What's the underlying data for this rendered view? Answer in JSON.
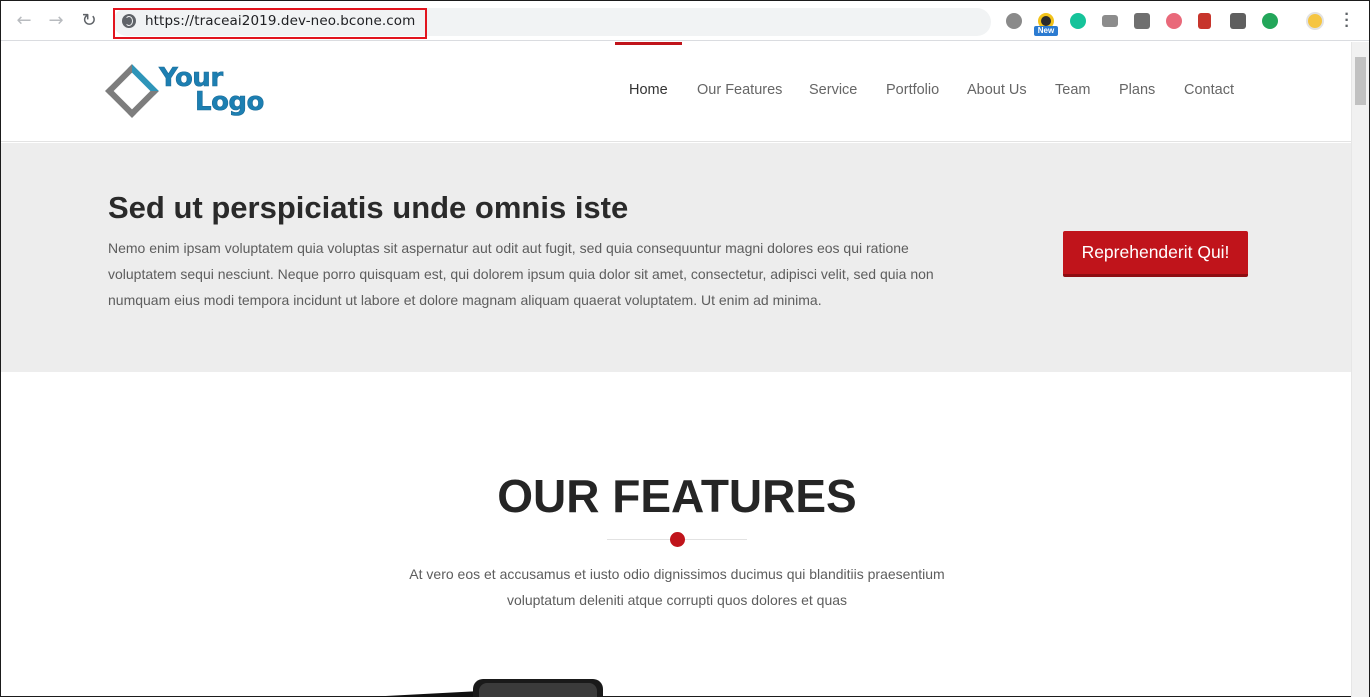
{
  "browser": {
    "url": "https://traceai2019.dev-neo.bcone.com",
    "back_icon": "←",
    "forward_icon": "→",
    "reload_icon": "↻",
    "new_badge": "New",
    "menu_icon": "⋮",
    "extensions": [
      "lock-ear-icon",
      "new-extension-icon",
      "grammarly-icon",
      "camera-icon",
      "pin-icon",
      "cookie-icon",
      "red-book-icon",
      "m-icon",
      "checkmark-icon",
      "profile-avatar-icon"
    ]
  },
  "header": {
    "logo_line1": "Your",
    "logo_line2": "Logo",
    "nav": [
      {
        "label": "Home"
      },
      {
        "label": "Our Features"
      },
      {
        "label": "Service"
      },
      {
        "label": "Portfolio"
      },
      {
        "label": "About Us"
      },
      {
        "label": "Team"
      },
      {
        "label": "Plans"
      },
      {
        "label": "Contact"
      }
    ],
    "active_color": "#c0141b"
  },
  "hero": {
    "title": "Sed ut perspiciatis unde omnis iste",
    "body": "Nemo enim ipsam voluptatem quia voluptas sit aspernatur aut odit aut fugit, sed quia consequuntur magni dolores eos qui ratione voluptatem sequi nesciunt. Neque porro quisquam est, qui dolorem ipsum quia dolor sit amet, consectetur, adipisci velit, sed quia non numquam eius modi tempora incidunt ut labore et dolore magnam aliquam quaerat voluptatem. Ut enim ad minima.",
    "cta_label": "Reprehenderit Qui!"
  },
  "features": {
    "title": "OUR FEATURES",
    "description": "At vero eos et accusamus et iusto odio dignissimos ducimus qui blanditiis praesentium voluptatum deleniti atque corrupti quos dolores et quas"
  }
}
